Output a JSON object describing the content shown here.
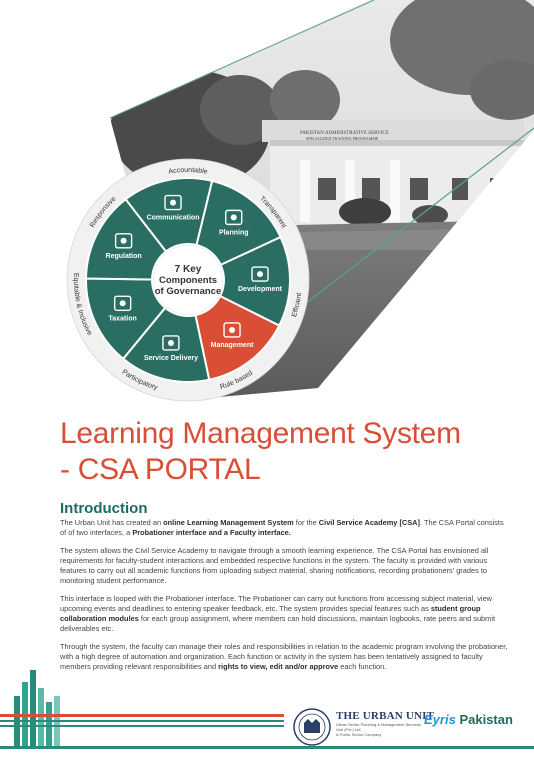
{
  "wheel": {
    "center": [
      "7 Key",
      "Components",
      "of Governance"
    ],
    "segments": [
      "Communication",
      "Planning",
      "Development",
      "Management",
      "Service Delivery",
      "Taxation",
      "Regulation"
    ],
    "outer": [
      "Accountable",
      "Transparent",
      "Efficient",
      "Rule based",
      "Participatory",
      "Equitable & Inclusive",
      "Responsive"
    ],
    "colors": {
      "teal": "#2a6e63",
      "red": "#d94e35",
      "ring": "#f1f1f1"
    }
  },
  "building_sign": [
    "PAKISTAN ADMINISTRATIVE SERVICE",
    "SPECIALIZED TRAINING PROGRAMME"
  ],
  "title_lines": [
    "Learning Management System",
    "- CSA PORTAL"
  ],
  "intro_heading": "Introduction",
  "paragraphs": [
    [
      {
        "t": "The Urban Unit has created an "
      },
      {
        "t": "online Learning Management System",
        "b": true
      },
      {
        "t": " for the "
      },
      {
        "t": "Civil Service Academy [CSA]",
        "b": true
      },
      {
        "t": ". The CSA Portal consists of of two interfaces, a "
      },
      {
        "t": "Probationer interface and a Faculty interface.",
        "b": true
      }
    ],
    [
      {
        "t": "The system allows the Civil Service Academy to navigate through a smooth learning experience. The CSA Portal has envisioned all requirements for faculty-student interactions and embedded respective functions in the system. The faculty is provided with various features to carry out all academic functions from uploading subject material, sharing notifications, recording probationers' grades to monitoring student performance."
      }
    ],
    [
      {
        "t": "This interface is looped with the Probationer interface. The Probationer can carry out functions from accessing subject material, view upcoming events and deadlines to entering speaker feedback, etc. The system provides special features such as "
      },
      {
        "t": "student group collaboration modules",
        "b": true
      },
      {
        "t": " for each group assignment, where members can hold discussions, maintain logbooks, rate peers and submit deliverables etc."
      }
    ],
    [
      {
        "t": "Through the system, the faculty can manage their roles and responsibilities in relation to the academic program involving the probationer, with a high degree of automation and organization. Each function or activity in the system has been tentatively assigned to faculty members providing relevant responsibilities and "
      },
      {
        "t": "rights to view, edit and/or approve",
        "b": true
      },
      {
        "t": " each function."
      }
    ]
  ],
  "footer": {
    "urban_unit": "THE URBAN UNIT",
    "urban_unit_sub": "Urban Sector Planning & Management Services Unit (Pvt.) Ltd",
    "urban_unit_sub2": "A Public Sector Company",
    "eyris_1": "Eyris",
    "eyris_2": "Pakistan"
  }
}
